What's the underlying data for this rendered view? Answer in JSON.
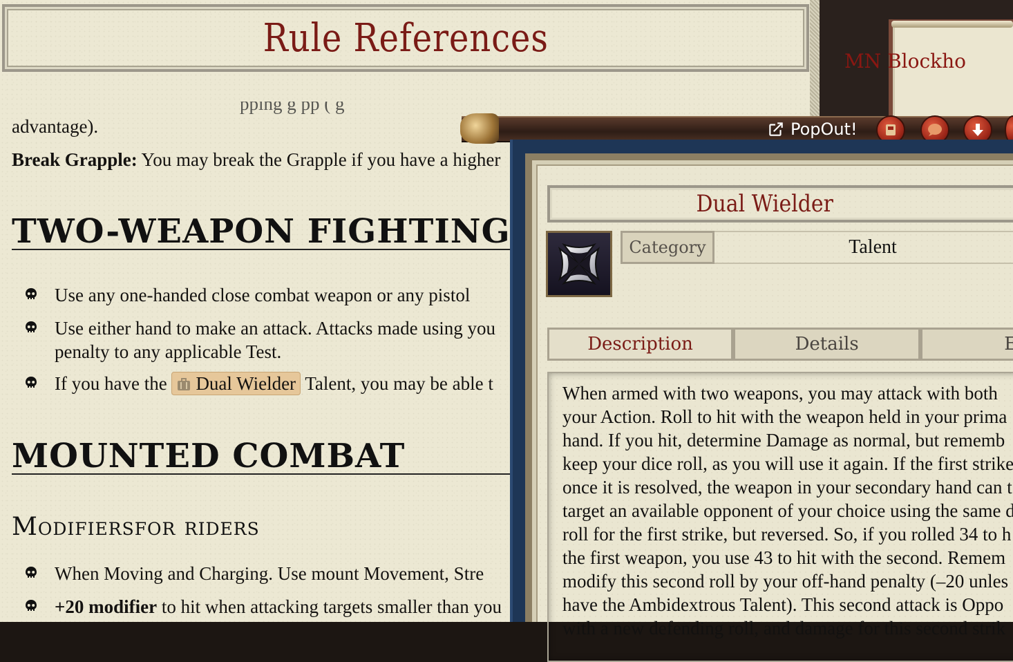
{
  "ref": {
    "title": "Rule References",
    "cut_line": "pping                                     g  pp  (  g",
    "advantage_text": "advantage).",
    "break_grapple_label": "Break Grapple:",
    "break_grapple_text": " You may break the Grapple if you have a higher",
    "two_weapon_heading": "TWO-WEAPON FIGHTING",
    "bullets_two": [
      "Use any one-handed close combat weapon or any pistol",
      "Use either hand to make an attack. Attacks made using you",
      "penalty to any applicable Test."
    ],
    "dual_pre": "If you have the ",
    "dual_link": "Dual Wielder",
    "dual_post": " Talent, you may be able t",
    "mounted_heading": "MOUNTED COMBAT",
    "sub_heading": "Modifiersfor riders",
    "bullet_mount_1": "When Moving and Charging. Use mount Movement, Stre",
    "bullet_mount_2_bold": "+20 modifier",
    "bullet_mount_2_text": " to hit when attacking targets smaller than you"
  },
  "background_window": {
    "title": "MN Blockho"
  },
  "popup": {
    "popout_label": "PopOut!",
    "title": "Dual Wielder",
    "category_label": "Category",
    "category_value": "Talent",
    "tabs": [
      "Description",
      "Details",
      "Effe"
    ],
    "description_lines": [
      "When armed with two weapons, you may attack with both",
      "your Action. Roll to hit with the weapon held in your prima",
      "hand. If you hit, determine Damage as normal, but rememb",
      "keep your dice roll, as you will use it again. If the first strike",
      "once it is resolved, the weapon in your secondary hand can t",
      "target an available opponent of your choice using the same d",
      "roll for the first strike, but reversed. So, if you rolled 34 to h",
      "the first weapon, you use 43 to hit with the second. Remem",
      "modify this second roll by your off-hand penalty (–20 unles",
      "have the Ambidextrous Talent). This second attack is Oppo",
      "with a new defending roll, and damage for this second strik"
    ]
  }
}
